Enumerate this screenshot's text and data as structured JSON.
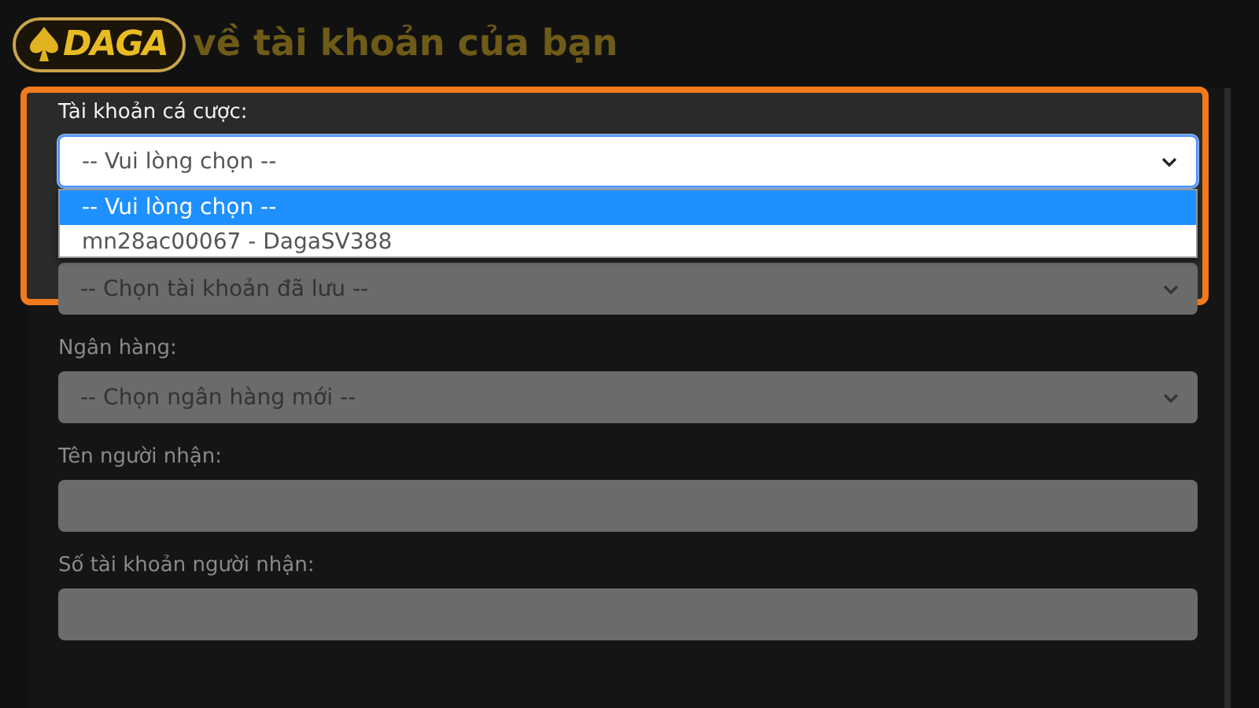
{
  "logo": {
    "text": "DAGA"
  },
  "heading": "về tài khoản của bạn",
  "betting_account": {
    "label": "Tài khoản cá cược:",
    "value": "-- Vui lòng chọn --",
    "expanded": true,
    "options": [
      {
        "label": "-- Vui lòng chọn --",
        "selected": true
      },
      {
        "label": "mn28ac00067 - DagaSV388",
        "selected": false
      }
    ]
  },
  "fields": [
    {
      "kind": "select",
      "value": "-- Chọn tài khoản đã lưu --"
    },
    {
      "kind": "select",
      "label": "Ngân hàng:",
      "value": "-- Chọn ngân hàng mới --"
    },
    {
      "kind": "input",
      "label": "Tên người nhận:"
    },
    {
      "kind": "input",
      "label": "Số tài khoản người nhận:"
    }
  ]
}
